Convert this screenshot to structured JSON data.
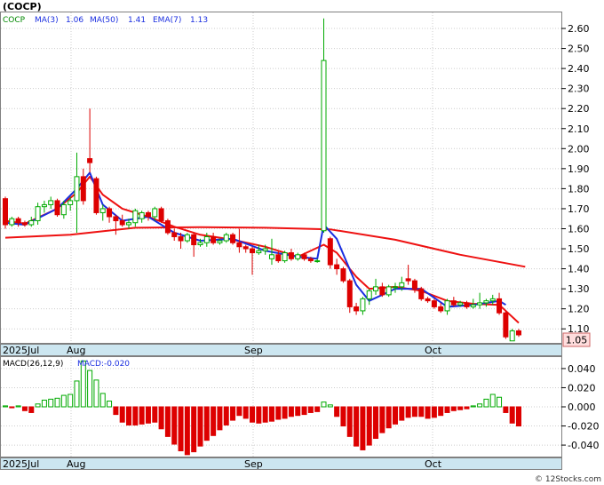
{
  "header": {
    "symbol": "(COCP)",
    "ticker": "COCP",
    "ma3_label": "MA(3)",
    "ma3_value": "1.06",
    "ma50_label": "MA(50)",
    "ma50_value": "1.41",
    "ema7_label": "EMA(7)",
    "ema7_value": "1.13"
  },
  "price_panel": {
    "y_ticks": [
      "2.60",
      "2.50",
      "2.40",
      "2.30",
      "2.20",
      "2.10",
      "2.00",
      "1.90",
      "1.80",
      "1.70",
      "1.60",
      "1.50",
      "1.40",
      "1.30",
      "1.20",
      "1.10"
    ],
    "last_price": "1.05",
    "x_labels": [
      "2025Jul",
      "Aug",
      "Sep",
      "Oct"
    ]
  },
  "macd_panel": {
    "label": "MACD(26,12,9)",
    "value_label": "MACD:-0.020",
    "y_ticks": [
      "0.040",
      "0.020",
      "0.000",
      "-0.020",
      "-0.040"
    ],
    "x_labels": [
      "2025Jul",
      "Aug",
      "Sep",
      "Oct"
    ]
  },
  "footer": {
    "watermark": "© 12Stocks.com"
  },
  "colors": {
    "up": "#00aa00",
    "down": "#dd0000",
    "ma_blue": "#1a2ee0",
    "ma_red": "#ee1111",
    "strip": "#cce6f0",
    "grid": "#cccccc"
  },
  "chart_data": [
    {
      "type": "candlestick",
      "title": "(COCP)",
      "ylim": [
        1.03,
        2.68
      ],
      "series": [
        {
          "name": "Price",
          "candles": [
            [
              1.75,
              1.76,
              1.6,
              1.62
            ],
            [
              1.62,
              1.66,
              1.61,
              1.65
            ],
            [
              1.65,
              1.66,
              1.61,
              1.63
            ],
            [
              1.63,
              1.64,
              1.61,
              1.62
            ],
            [
              1.62,
              1.66,
              1.61,
              1.64
            ],
            [
              1.64,
              1.73,
              1.62,
              1.71
            ],
            [
              1.71,
              1.74,
              1.68,
              1.72
            ],
            [
              1.72,
              1.76,
              1.7,
              1.74
            ],
            [
              1.74,
              1.75,
              1.66,
              1.67
            ],
            [
              1.67,
              1.74,
              1.65,
              1.72
            ],
            [
              1.72,
              1.76,
              1.69,
              1.74
            ],
            [
              1.74,
              1.98,
              1.58,
              1.86
            ],
            [
              1.86,
              1.9,
              1.72,
              1.74
            ],
            [
              1.95,
              2.2,
              1.88,
              1.93
            ],
            [
              1.85,
              1.86,
              1.67,
              1.68
            ],
            [
              1.68,
              1.72,
              1.64,
              1.7
            ],
            [
              1.7,
              1.71,
              1.63,
              1.66
            ],
            [
              1.66,
              1.67,
              1.57,
              1.64
            ],
            [
              1.64,
              1.67,
              1.61,
              1.62
            ],
            [
              1.62,
              1.65,
              1.6,
              1.63
            ],
            [
              1.63,
              1.7,
              1.61,
              1.69
            ],
            [
              1.65,
              1.69,
              1.63,
              1.68
            ],
            [
              1.68,
              1.69,
              1.64,
              1.66
            ],
            [
              1.66,
              1.71,
              1.64,
              1.7
            ],
            [
              1.7,
              1.71,
              1.63,
              1.64
            ],
            [
              1.64,
              1.65,
              1.57,
              1.58
            ],
            [
              1.58,
              1.6,
              1.54,
              1.56
            ],
            [
              1.56,
              1.58,
              1.5,
              1.54
            ],
            [
              1.54,
              1.58,
              1.53,
              1.57
            ],
            [
              1.57,
              1.58,
              1.46,
              1.52
            ],
            [
              1.52,
              1.55,
              1.51,
              1.53
            ],
            [
              1.53,
              1.58,
              1.51,
              1.56
            ],
            [
              1.56,
              1.58,
              1.52,
              1.53
            ],
            [
              1.53,
              1.55,
              1.52,
              1.54
            ],
            [
              1.54,
              1.58,
              1.53,
              1.57
            ],
            [
              1.57,
              1.58,
              1.52,
              1.53
            ],
            [
              1.53,
              1.6,
              1.48,
              1.51
            ],
            [
              1.51,
              1.52,
              1.48,
              1.5
            ],
            [
              1.5,
              1.51,
              1.37,
              1.48
            ],
            [
              1.48,
              1.52,
              1.47,
              1.49
            ],
            [
              1.49,
              1.52,
              1.47,
              1.5
            ],
            [
              1.45,
              1.55,
              1.42,
              1.47
            ],
            [
              1.47,
              1.49,
              1.43,
              1.44
            ],
            [
              1.44,
              1.49,
              1.43,
              1.48
            ],
            [
              1.48,
              1.5,
              1.44,
              1.45
            ],
            [
              1.45,
              1.48,
              1.44,
              1.47
            ],
            [
              1.47,
              1.48,
              1.44,
              1.45
            ],
            [
              1.45,
              1.46,
              1.43,
              1.44
            ],
            [
              1.44,
              1.45,
              1.43,
              1.44
            ],
            [
              1.59,
              2.65,
              1.58,
              2.44
            ],
            [
              1.55,
              1.56,
              1.4,
              1.42
            ],
            [
              1.42,
              1.45,
              1.37,
              1.4
            ],
            [
              1.4,
              1.41,
              1.33,
              1.34
            ],
            [
              1.34,
              1.35,
              1.18,
              1.21
            ],
            [
              1.21,
              1.23,
              1.17,
              1.19
            ],
            [
              1.19,
              1.26,
              1.17,
              1.25
            ],
            [
              1.25,
              1.3,
              1.22,
              1.29
            ],
            [
              1.29,
              1.35,
              1.27,
              1.31
            ],
            [
              1.31,
              1.33,
              1.26,
              1.27
            ],
            [
              1.27,
              1.32,
              1.26,
              1.31
            ],
            [
              1.31,
              1.33,
              1.28,
              1.31
            ],
            [
              1.31,
              1.36,
              1.29,
              1.33
            ],
            [
              1.35,
              1.42,
              1.32,
              1.34
            ],
            [
              1.34,
              1.35,
              1.28,
              1.3
            ],
            [
              1.3,
              1.31,
              1.24,
              1.25
            ],
            [
              1.25,
              1.26,
              1.23,
              1.24
            ],
            [
              1.24,
              1.25,
              1.2,
              1.21
            ],
            [
              1.21,
              1.23,
              1.18,
              1.19
            ],
            [
              1.19,
              1.25,
              1.17,
              1.24
            ],
            [
              1.24,
              1.26,
              1.21,
              1.22
            ],
            [
              1.22,
              1.24,
              1.21,
              1.23
            ],
            [
              1.23,
              1.24,
              1.2,
              1.21
            ],
            [
              1.21,
              1.25,
              1.2,
              1.22
            ],
            [
              1.22,
              1.28,
              1.2,
              1.23
            ],
            [
              1.23,
              1.25,
              1.21,
              1.24
            ],
            [
              1.24,
              1.27,
              1.22,
              1.25
            ],
            [
              1.25,
              1.28,
              1.17,
              1.18
            ],
            [
              1.18,
              1.19,
              1.05,
              1.06
            ],
            [
              1.04,
              1.1,
              1.04,
              1.09
            ],
            [
              1.09,
              1.1,
              1.06,
              1.07
            ]
          ]
        },
        {
          "name": "MA(50)",
          "knots": [
            [
              0,
              1.555
            ],
            [
              10,
              1.57
            ],
            [
              20,
              1.605
            ],
            [
              30,
              1.608
            ],
            [
              40,
              1.605
            ],
            [
              50,
              1.597
            ],
            [
              60,
              1.545
            ],
            [
              70,
              1.47
            ],
            [
              80,
              1.41
            ]
          ]
        },
        {
          "name": "EMA(7)",
          "knots": [
            [
              0,
              1.64
            ],
            [
              3,
              1.625
            ],
            [
              8,
              1.7
            ],
            [
              11,
              1.78
            ],
            [
              13,
              1.86
            ],
            [
              15,
              1.77
            ],
            [
              18,
              1.7
            ],
            [
              22,
              1.66
            ],
            [
              26,
              1.61
            ],
            [
              30,
              1.57
            ],
            [
              35,
              1.545
            ],
            [
              40,
              1.51
            ],
            [
              45,
              1.46
            ],
            [
              49,
              1.52
            ],
            [
              51,
              1.48
            ],
            [
              54,
              1.36
            ],
            [
              56,
              1.3
            ],
            [
              60,
              1.31
            ],
            [
              64,
              1.29
            ],
            [
              68,
              1.24
            ],
            [
              72,
              1.225
            ],
            [
              76,
              1.22
            ],
            [
              79,
              1.13
            ]
          ]
        },
        {
          "name": "MA(3)",
          "knots": [
            [
              0,
              1.63
            ],
            [
              3,
              1.62
            ],
            [
              8,
              1.7
            ],
            [
              11,
              1.8
            ],
            [
              13,
              1.88
            ],
            [
              15,
              1.72
            ],
            [
              18,
              1.64
            ],
            [
              22,
              1.66
            ],
            [
              26,
              1.58
            ],
            [
              30,
              1.54
            ],
            [
              35,
              1.55
            ],
            [
              40,
              1.49
            ],
            [
              45,
              1.46
            ],
            [
              48,
              1.45
            ],
            [
              49,
              1.62
            ],
            [
              51,
              1.55
            ],
            [
              54,
              1.32
            ],
            [
              56,
              1.24
            ],
            [
              60,
              1.3
            ],
            [
              64,
              1.3
            ],
            [
              68,
              1.21
            ],
            [
              72,
              1.22
            ],
            [
              76,
              1.24
            ],
            [
              77,
              1.22
            ]
          ]
        }
      ]
    },
    {
      "type": "bar",
      "title": "MACD(26,12,9)",
      "ylim": [
        -0.052,
        0.052
      ],
      "series": [
        {
          "name": "MACD",
          "values": [
            0.001,
            -0.001,
            0.001,
            -0.004,
            -0.006,
            0.003,
            0.007,
            0.008,
            0.009,
            0.012,
            0.013,
            0.027,
            0.048,
            0.038,
            0.028,
            0.014,
            0.006,
            -0.008,
            -0.016,
            -0.019,
            -0.019,
            -0.018,
            -0.017,
            -0.016,
            -0.023,
            -0.031,
            -0.039,
            -0.046,
            -0.05,
            -0.047,
            -0.041,
            -0.035,
            -0.03,
            -0.024,
            -0.019,
            -0.014,
            -0.009,
            -0.012,
            -0.016,
            -0.017,
            -0.016,
            -0.015,
            -0.013,
            -0.012,
            -0.01,
            -0.009,
            -0.008,
            -0.006,
            -0.005,
            0.005,
            0.002,
            -0.01,
            -0.02,
            -0.031,
            -0.041,
            -0.045,
            -0.04,
            -0.033,
            -0.027,
            -0.022,
            -0.018,
            -0.014,
            -0.011,
            -0.01,
            -0.01,
            -0.012,
            -0.011,
            -0.009,
            -0.006,
            -0.004,
            -0.003,
            -0.002,
            0.001,
            0.003,
            0.008,
            0.013,
            0.01,
            -0.006,
            -0.017,
            -0.02
          ]
        }
      ]
    }
  ]
}
